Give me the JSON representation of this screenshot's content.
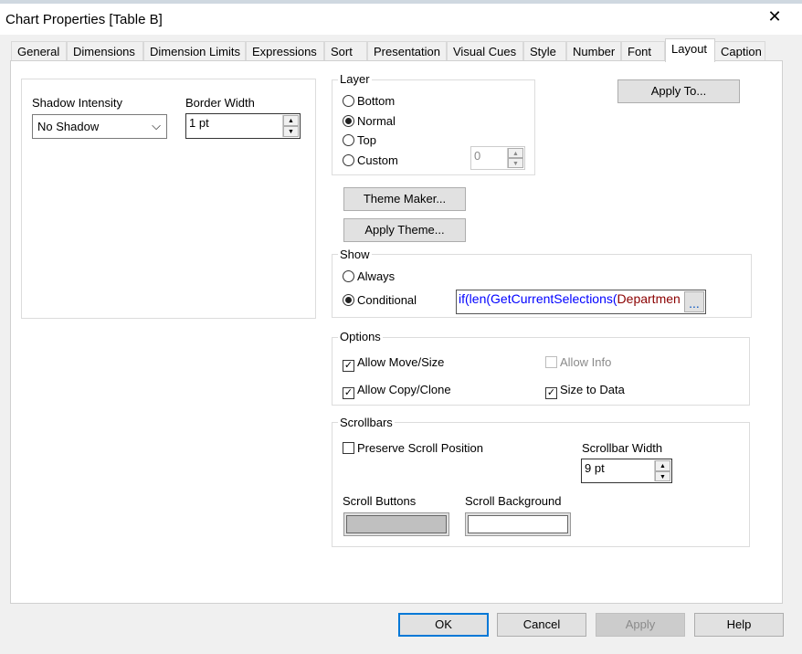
{
  "window": {
    "title": "Chart Properties [Table B]",
    "close_icon": "close-icon"
  },
  "tabs": [
    {
      "label": "General"
    },
    {
      "label": "Dimensions"
    },
    {
      "label": "Dimension Limits"
    },
    {
      "label": "Expressions"
    },
    {
      "label": "Sort"
    },
    {
      "label": "Presentation"
    },
    {
      "label": "Visual Cues"
    },
    {
      "label": "Style"
    },
    {
      "label": "Number"
    },
    {
      "label": "Font"
    },
    {
      "label": "Layout",
      "active": true
    },
    {
      "label": "Caption"
    }
  ],
  "shadow": {
    "label": "Shadow Intensity",
    "value": "No Shadow"
  },
  "border": {
    "label": "Border Width",
    "value": "1 pt"
  },
  "layer": {
    "label": "Layer",
    "options": [
      "Bottom",
      "Normal",
      "Top",
      "Custom"
    ],
    "selected": "Normal",
    "custom_value": "0"
  },
  "apply_to": "Apply To...",
  "theme_maker": "Theme Maker...",
  "apply_theme": "Apply Theme...",
  "show": {
    "label": "Show",
    "always": "Always",
    "conditional": "Conditional",
    "selected": "Conditional",
    "expr": {
      "p1": "if(",
      "p2": "len",
      "p3": "(",
      "p4": "GetCurrentSelections",
      "p5": "(",
      "p6": "Departmen"
    },
    "more": "..."
  },
  "options": {
    "label": "Options",
    "allow_move": "Allow Move/Size",
    "allow_info": "Allow Info",
    "allow_copy": "Allow Copy/Clone",
    "size_to_data": "Size to Data"
  },
  "scrollbars": {
    "label": "Scrollbars",
    "preserve": "Preserve Scroll Position",
    "width_label": "Scrollbar Width",
    "width_value": "9 pt",
    "buttons_label": "Scroll Buttons",
    "background_label": "Scroll Background",
    "buttons_color": "#c0c0c0",
    "background_color": "#ffffff"
  },
  "footer": {
    "ok": "OK",
    "cancel": "Cancel",
    "apply": "Apply",
    "help": "Help"
  }
}
